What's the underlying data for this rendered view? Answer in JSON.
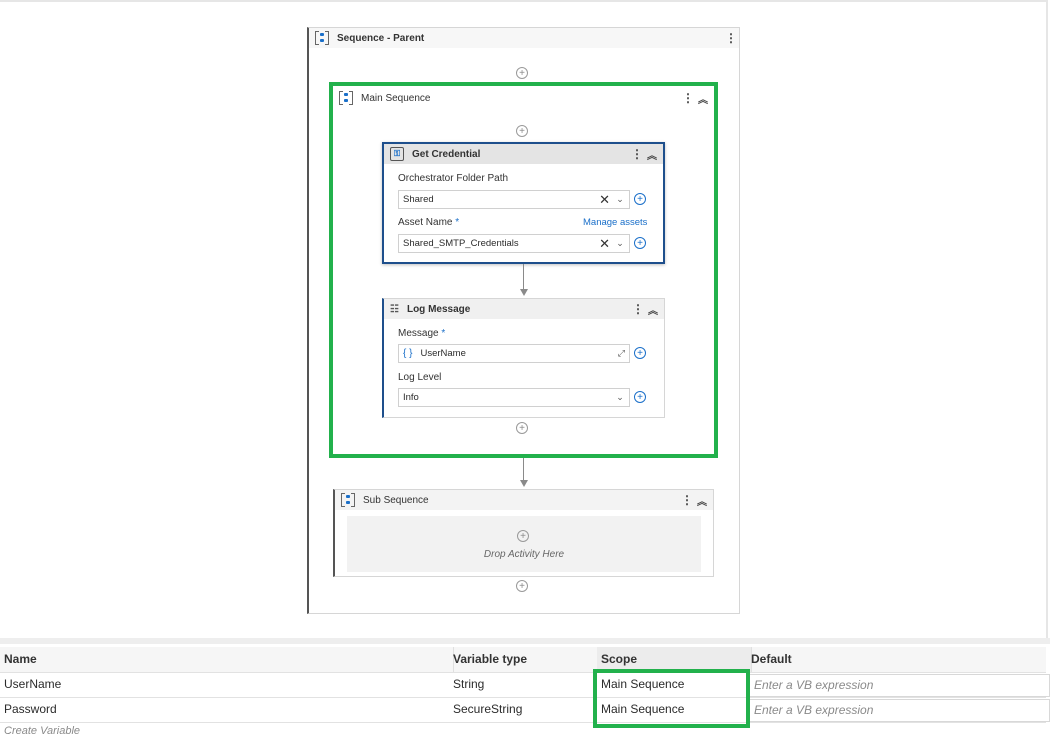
{
  "workflow": {
    "parent": {
      "title": "Sequence - Parent"
    },
    "main": {
      "title": "Main Sequence"
    },
    "get_credential": {
      "title": "Get Credential",
      "folder_label": "Orchestrator Folder Path",
      "folder_value": "Shared",
      "asset_label": "Asset Name",
      "asset_required": "*",
      "manage_assets": "Manage assets",
      "asset_value": "Shared_SMTP_Credentials"
    },
    "log_message": {
      "title": "Log Message",
      "message_label": "Message",
      "message_required": "*",
      "message_value": "UserName",
      "level_label": "Log Level",
      "level_value": "Info"
    },
    "sub": {
      "title": "Sub Sequence",
      "drop_text": "Drop Activity Here"
    }
  },
  "variables": {
    "columns": [
      "Name",
      "Variable type",
      "Scope",
      "Default"
    ],
    "rows": [
      {
        "name": "UserName",
        "type": "String",
        "scope": "Main Sequence",
        "default_placeholder": "Enter a VB expression"
      },
      {
        "name": "Password",
        "type": "SecureString",
        "scope": "Main Sequence",
        "default_placeholder": "Enter a VB expression"
      }
    ],
    "create_label": "Create Variable"
  },
  "icons": {
    "sequence": "sequence-icon",
    "credential": "credential-icon",
    "log": "log-message-icon",
    "add": "add-activity-icon",
    "kebab": "more-options-icon",
    "collapse": "collapse-icon",
    "clear": "clear-icon",
    "dropdown": "dropdown-icon",
    "expression": "expression-icon",
    "expand": "expand-editor-icon"
  },
  "colors": {
    "highlight": "#22b14c",
    "accent": "#1a6fc9"
  }
}
